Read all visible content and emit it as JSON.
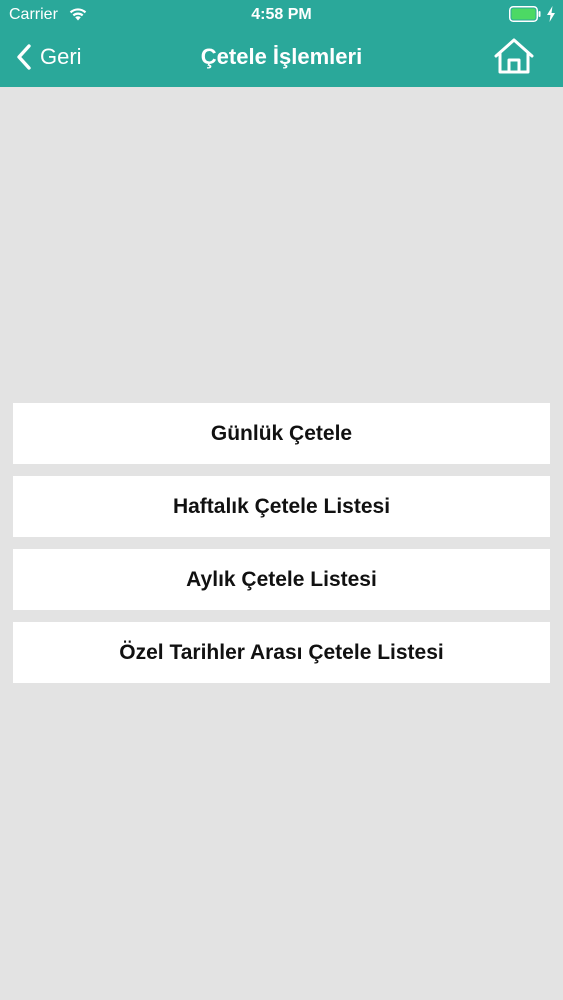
{
  "status_bar": {
    "carrier": "Carrier",
    "time": "4:58 PM"
  },
  "nav": {
    "back_label": "Geri",
    "title": "Çetele İşlemleri",
    "back_icon": "chevron-left-icon",
    "home_icon": "home-icon"
  },
  "menu": {
    "items": [
      {
        "label": "Günlük Çetele"
      },
      {
        "label": "Haftalık Çetele Listesi"
      },
      {
        "label": "Aylık Çetele Listesi"
      },
      {
        "label": "Özel Tarihler Arası Çetele Listesi"
      }
    ]
  },
  "colors": {
    "header": "#2aa89a",
    "background": "#e3e3e3",
    "item_background": "#ffffff",
    "battery": "#4cd964"
  }
}
